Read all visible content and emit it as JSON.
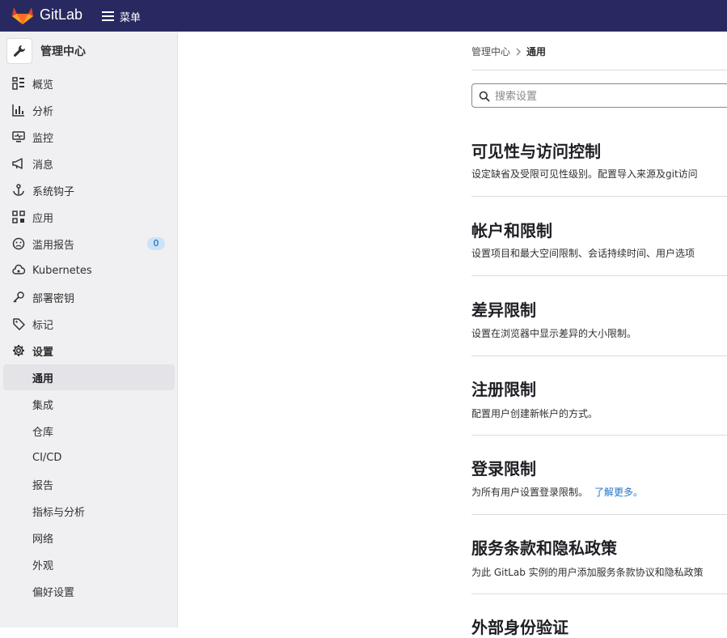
{
  "topbar": {
    "brand": "GitLab",
    "menu_label": "菜单"
  },
  "sidebar": {
    "context_title": "管理中心",
    "items": [
      {
        "label": "概览"
      },
      {
        "label": "分析"
      },
      {
        "label": "监控"
      },
      {
        "label": "消息"
      },
      {
        "label": "系统钩子"
      },
      {
        "label": "应用"
      },
      {
        "label": "滥用报告",
        "badge": "0"
      },
      {
        "label": "Kubernetes"
      },
      {
        "label": "部署密钥"
      },
      {
        "label": "标记"
      },
      {
        "label": "设置"
      }
    ],
    "settings_sub": [
      {
        "label": "通用"
      },
      {
        "label": "集成"
      },
      {
        "label": "仓库"
      },
      {
        "label": "CI/CD"
      },
      {
        "label": "报告"
      },
      {
        "label": "指标与分析"
      },
      {
        "label": "网络"
      },
      {
        "label": "外观"
      },
      {
        "label": "偏好设置"
      }
    ]
  },
  "breadcrumb": {
    "parent": "管理中心",
    "current": "通用"
  },
  "search": {
    "placeholder": "搜索设置"
  },
  "sections": [
    {
      "title": "可见性与访问控制",
      "desc": "设定缺省及受限可见性级别。配置导入来源及git访问"
    },
    {
      "title": "帐户和限制",
      "desc": "设置项目和最大空间限制、会话持续时间、用户选项"
    },
    {
      "title": "差异限制",
      "desc": "设置在浏览器中显示差异的大小限制。"
    },
    {
      "title": "注册限制",
      "desc": "配置用户创建新帐户的方式。"
    },
    {
      "title": "登录限制",
      "desc": "为所有用户设置登录限制。",
      "link": "了解更多。"
    },
    {
      "title": "服务条款和隐私政策",
      "desc": "为此 GitLab 实例的用户添加服务条款协议和隐私政策"
    },
    {
      "title": "外部身份验证",
      "desc": ""
    }
  ]
}
